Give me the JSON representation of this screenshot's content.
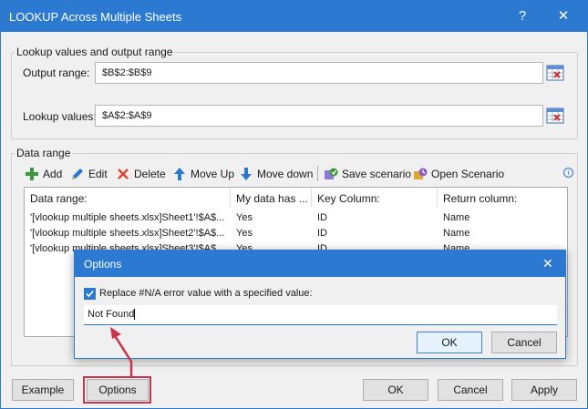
{
  "window": {
    "title": "LOOKUP Across Multiple Sheets",
    "help_glyph": "?",
    "close_glyph": "✕"
  },
  "lookup_group": {
    "title": "Lookup values and output range",
    "output_label": "Output range:",
    "output_value": "$B$2:$B$9",
    "lookup_label": "Lookup values:",
    "lookup_value": "$A$2:$A$9"
  },
  "data_group": {
    "title": "Data range",
    "toolbar": {
      "add": "Add",
      "edit": "Edit",
      "delete": "Delete",
      "move_up": "Move Up",
      "move_down": "Move down",
      "save_scenario": "Save scenario",
      "open_scenario": "Open Scenario",
      "info_glyph": "i"
    },
    "columns": [
      "Data range:",
      "My data has ...",
      "Key Column:",
      "Return column:"
    ],
    "rows": [
      [
        "'[vlookup multiple sheets.xlsx]Sheet1'!$A$...",
        "Yes",
        "ID",
        "Name"
      ],
      [
        "'[vlookup multiple sheets.xlsx]Sheet2'!$A$...",
        "Yes",
        "ID",
        "Name"
      ],
      [
        "'[vlookup multiple sheets.xlsx]Sheet3'!$A$...",
        "Yes",
        "ID",
        "Name"
      ]
    ]
  },
  "buttons": {
    "example": "Example",
    "options": "Options",
    "ok": "OK",
    "cancel": "Cancel",
    "apply": "Apply"
  },
  "options_dialog": {
    "title": "Options",
    "close_glyph": "✕",
    "checkbox_label": "Replace #N/A error value with a specified value:",
    "checkbox_checked": true,
    "value": "Not Found",
    "ok": "OK",
    "cancel": "Cancel"
  },
  "colors": {
    "titlebar": "#2b79d0",
    "annotation": "#c7344b"
  },
  "icons": {
    "add": "plus-icon",
    "edit": "pencil-icon",
    "delete": "x-icon",
    "move_up": "arrow-up-icon",
    "move_down": "arrow-down-icon",
    "save_scenario": "save-scenario-icon",
    "open_scenario": "open-scenario-icon",
    "range_picker": "range-select-icon"
  }
}
